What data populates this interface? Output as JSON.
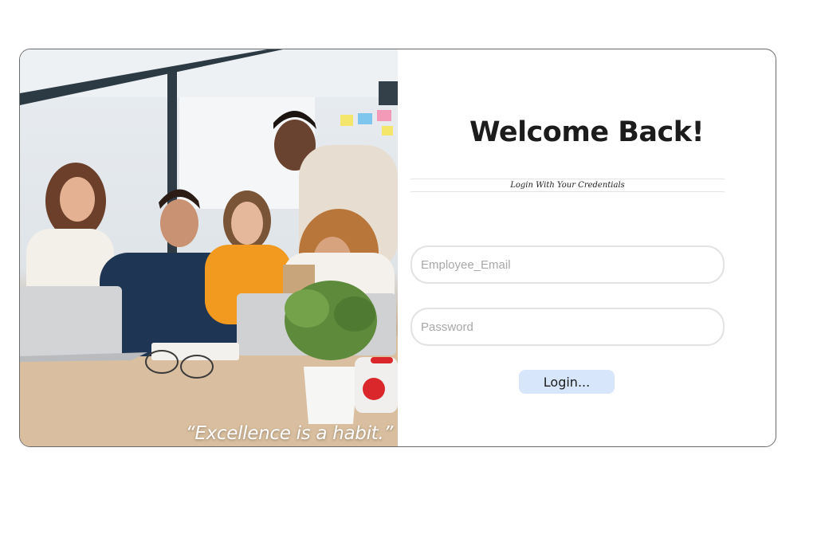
{
  "hero": {
    "quote": "“Excellence is a habit.”",
    "image_description": "team-of-coworkers-at-laptops"
  },
  "login": {
    "title": "Welcome Back!",
    "subtitle": "Login With Your Credentials",
    "email_placeholder": "Employee_Email",
    "password_placeholder": "Password",
    "button_label": "Login..."
  },
  "colors": {
    "button_bg": "#d7e6fb",
    "card_border": "#6b6b6b",
    "input_border": "#e2e2e2"
  }
}
